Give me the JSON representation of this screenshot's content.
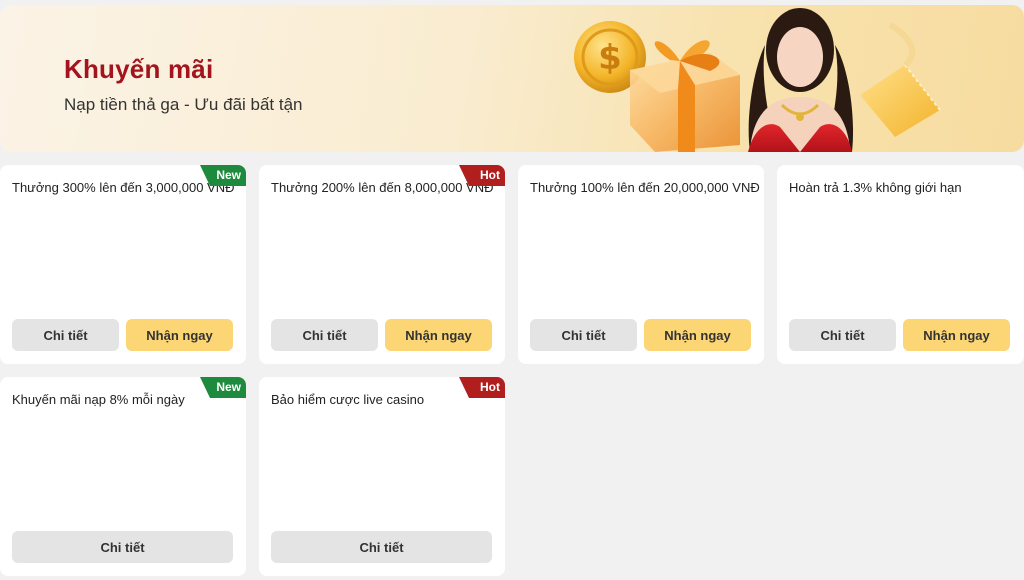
{
  "banner": {
    "title": "Khuyến mãi",
    "subtitle": "Nạp tiền thả ga - Ưu đãi bất tận"
  },
  "colors": {
    "title_red": "#a3141f",
    "claim_yellow": "#fcd674",
    "detail_gray": "#e4e4e4",
    "badge_new": "#1e8a3e",
    "badge_hot": "#b01e1e"
  },
  "promotions": [
    {
      "title": "Thưởng 300% lên đến 3,000,000 VNĐ",
      "badge": "New",
      "detail_label": "Chi tiết",
      "claim_label": "Nhận ngay"
    },
    {
      "title": "Thưởng 200% lên đến 8,000,000 VNĐ",
      "badge": "Hot",
      "detail_label": "Chi tiết",
      "claim_label": "Nhận ngay"
    },
    {
      "title": "Thưởng 100% lên đến 20,000,000 VNĐ",
      "badge": "",
      "detail_label": "Chi tiết",
      "claim_label": "Nhận ngay"
    },
    {
      "title": "Hoàn trả 1.3% không giới hạn",
      "badge": "",
      "detail_label": "Chi tiết",
      "claim_label": "Nhận ngay"
    },
    {
      "title": "Khuyến mãi nạp 8% mỗi ngày",
      "badge": "New",
      "detail_label": "Chi tiết"
    },
    {
      "title": "Bảo hiểm cược live casino",
      "badge": "Hot",
      "detail_label": "Chi tiết"
    }
  ]
}
